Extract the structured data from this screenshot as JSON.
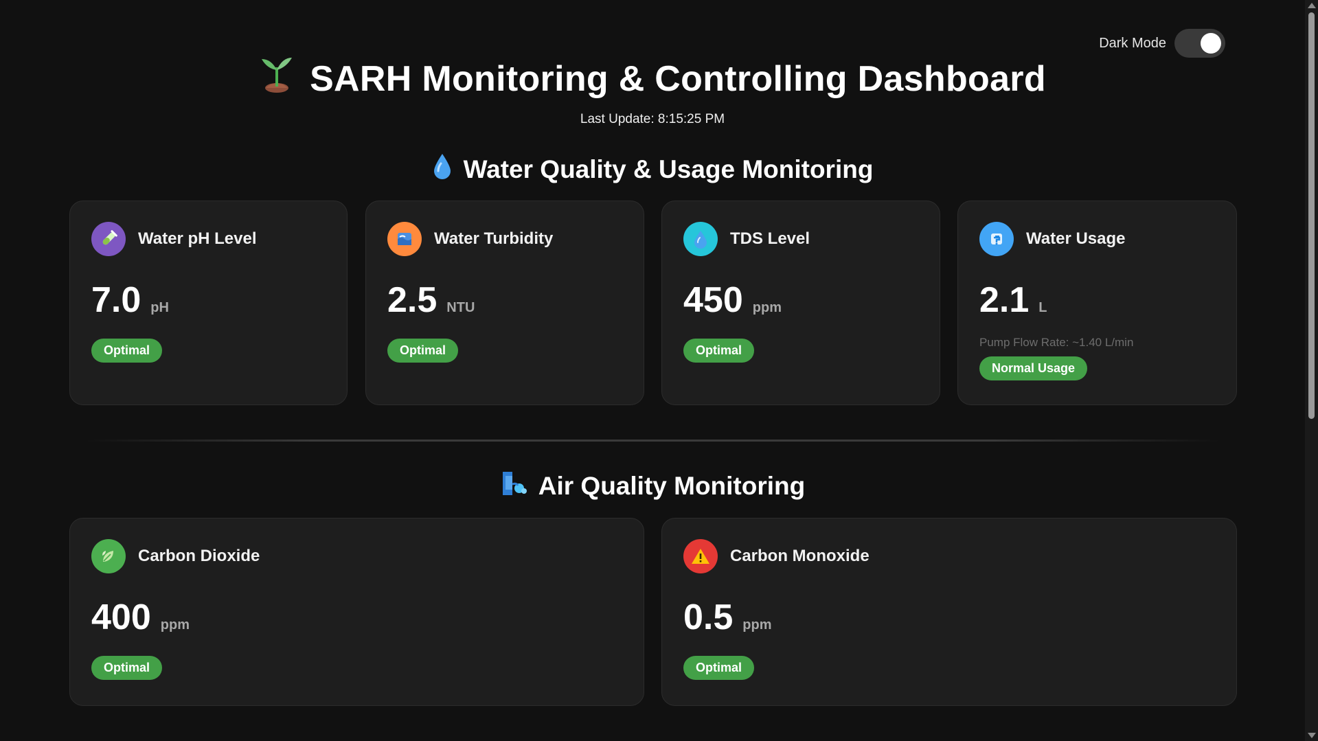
{
  "toggle": {
    "label": "Dark Mode",
    "checked": true
  },
  "header": {
    "title": "SARH Monitoring & Controlling Dashboard",
    "icon": "seedling-icon",
    "last_update": "Last Update: 8:15:25 PM"
  },
  "water_section": {
    "title": "Water Quality & Usage Monitoring",
    "icon": "droplet-icon",
    "cards": [
      {
        "title": "Water pH Level",
        "icon": "test-tube-icon",
        "value": "7.0",
        "unit": "pH",
        "status": "Optimal",
        "icon_color": "#7e57c2"
      },
      {
        "title": "Water Turbidity",
        "icon": "water-wave-icon",
        "value": "2.5",
        "unit": "NTU",
        "status": "Optimal",
        "icon_color": "#ff8a3d"
      },
      {
        "title": "TDS Level",
        "icon": "drop-icon",
        "value": "450",
        "unit": "ppm",
        "status": "Optimal",
        "icon_color": "#26c6da"
      },
      {
        "title": "Water Usage",
        "icon": "faucet-icon",
        "value": "2.1",
        "unit": "L",
        "subtext": "Pump Flow Rate: ~1.40 L/min",
        "status": "Normal Usage",
        "icon_color": "#42a5f5"
      }
    ]
  },
  "air_section": {
    "title": "Air Quality Monitoring",
    "icon": "wind-face-icon",
    "cards": [
      {
        "title": "Carbon Dioxide",
        "icon": "leaf-icon",
        "value": "400",
        "unit": "ppm",
        "status": "Optimal",
        "icon_color": "#4caf50"
      },
      {
        "title": "Carbon Monoxide",
        "icon": "warning-icon",
        "value": "0.5",
        "unit": "ppm",
        "status": "Optimal",
        "icon_color": "#e53935"
      }
    ]
  },
  "colors": {
    "background": "#111111",
    "card": "#1e1e1e",
    "status_ok": "#43a047"
  }
}
